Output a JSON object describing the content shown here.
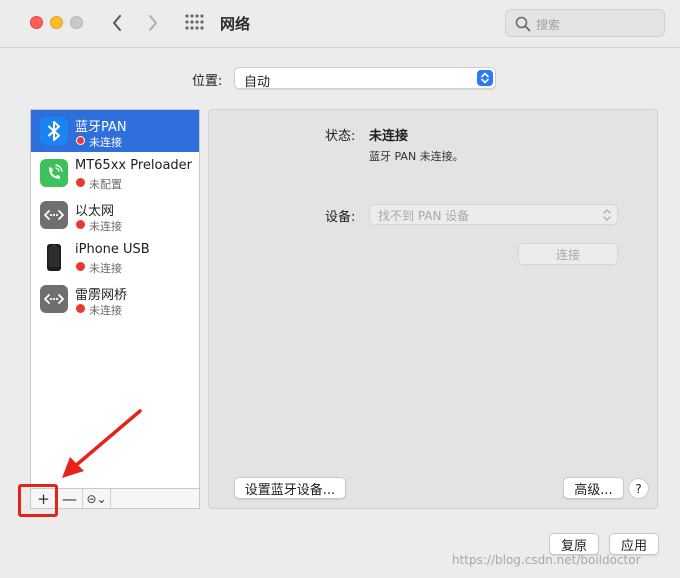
{
  "window": {
    "title": "网络",
    "search_placeholder": "搜索"
  },
  "location": {
    "label": "位置:",
    "value": "自动"
  },
  "services": [
    {
      "name": "蓝牙PAN",
      "status": "未连接",
      "icon": "bluetooth-icon",
      "selected": true
    },
    {
      "name": "MT65xx Preloader",
      "status": "未配置",
      "icon": "phone-modem-icon",
      "selected": false
    },
    {
      "name": "以太网",
      "status": "未连接",
      "icon": "ethernet-icon",
      "selected": false
    },
    {
      "name": "iPhone USB",
      "status": "未连接",
      "icon": "iphone-icon",
      "selected": false
    },
    {
      "name": "雷雳网桥",
      "status": "未连接",
      "icon": "thunderbolt-bridge-icon",
      "selected": false
    }
  ],
  "sidebar_buttons": {
    "add": "+",
    "remove": "—",
    "action": "⊝⌄"
  },
  "detail": {
    "status_label": "状态:",
    "status_value": "未连接",
    "status_desc": "蓝牙 PAN 未连接。",
    "device_label": "设备:",
    "device_value": "找不到 PAN 设备",
    "connect_label": "连接",
    "setup_label": "设置蓝牙设备...",
    "advanced_label": "高级...",
    "help_label": "?"
  },
  "footer": {
    "revert_label": "复原",
    "apply_label": "应用"
  },
  "watermark": "https://blog.csdn.net/boildoctor",
  "colors": {
    "selection": "#2f6fdb",
    "status_dot": "#e8382f",
    "annotation": "#e5231b"
  }
}
